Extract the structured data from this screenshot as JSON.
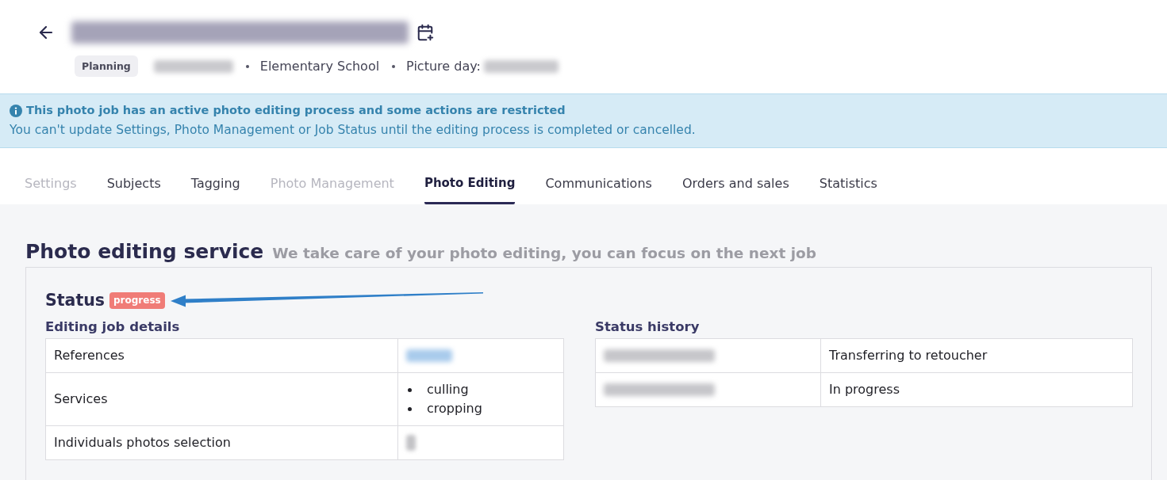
{
  "header": {
    "title": {
      "kind": "redacted"
    },
    "status_badge": "Planning",
    "meta": [
      {
        "kind": "redacted"
      },
      {
        "kind": "text",
        "text": "Elementary School"
      },
      {
        "kind": "labeled",
        "label": "Picture day:",
        "value": {
          "kind": "redacted"
        }
      }
    ]
  },
  "banner": {
    "title": "This photo job has an active photo editing process and some actions are restricted",
    "message": "You can't update Settings, Photo Management or Job Status until the editing process is completed or cancelled."
  },
  "tabs": [
    {
      "label": "Settings",
      "selected": false,
      "disabled": true
    },
    {
      "label": "Subjects",
      "selected": false,
      "disabled": false
    },
    {
      "label": "Tagging",
      "selected": false,
      "disabled": false
    },
    {
      "label": "Photo Management",
      "selected": false,
      "disabled": true
    },
    {
      "label": "Photo Editing",
      "selected": true,
      "disabled": false
    },
    {
      "label": "Communications",
      "selected": false,
      "disabled": false
    },
    {
      "label": "Orders and sales",
      "selected": false,
      "disabled": false
    },
    {
      "label": "Statistics",
      "selected": false,
      "disabled": false
    }
  ],
  "section": {
    "title": "Photo editing service",
    "subtitle": "We take care of your photo editing, you can focus on the next job"
  },
  "status": {
    "label": "Status",
    "badge": "progress",
    "annotations": [
      {
        "kind": "arrow"
      }
    ]
  },
  "details": {
    "title": "Editing job details",
    "rows": [
      {
        "label": "References",
        "value": {
          "kind": "redacted",
          "link": true
        }
      },
      {
        "label": "Services",
        "value": {
          "kind": "list",
          "items": [
            "culling",
            "cropping"
          ]
        }
      },
      {
        "label": "Individuals photos selection",
        "value": {
          "kind": "redacted",
          "link": false
        }
      }
    ]
  },
  "history": {
    "title": "Status history",
    "rows": [
      {
        "date": {
          "kind": "redacted"
        },
        "status": "Transferring to retoucher"
      },
      {
        "date": {
          "kind": "redacted"
        },
        "status": "In progress"
      }
    ]
  }
}
